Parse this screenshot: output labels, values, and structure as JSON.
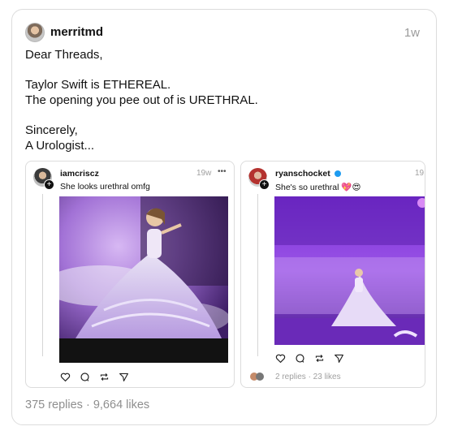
{
  "post": {
    "username": "merritmd",
    "time": "1w",
    "lines": [
      "Dear Threads,",
      "Taylor Swift is ETHEREAL.",
      "The opening you pee out of is URETHRAL.",
      "Sincerely,",
      "A Urologist..."
    ],
    "replies": "375 replies",
    "separator": "·",
    "likes": "9,664 likes"
  },
  "embeds": [
    {
      "username": "iamcriscz",
      "time": "19w",
      "more": "•••",
      "text": "She looks urethral omfg"
    },
    {
      "username": "ryanschocket",
      "verified": true,
      "time": "19",
      "text": "She's so urethral",
      "emoji": "💖😍",
      "reply_stats": "2 replies · 23 likes"
    }
  ],
  "icons": [
    "heart-icon",
    "comment-icon",
    "repost-icon",
    "share-icon",
    "plus-icon",
    "verified-icon"
  ],
  "colors": {
    "border": "#dcdcdc",
    "muted": "#8e8e8e",
    "verified": "#1d9bf0"
  }
}
